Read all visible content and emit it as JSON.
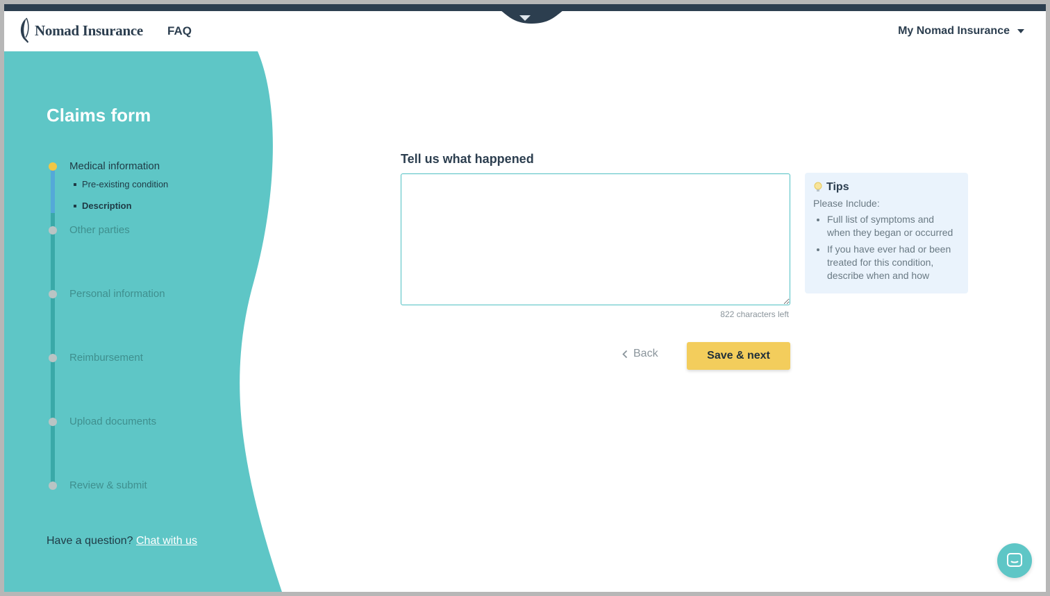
{
  "header": {
    "logo_text": "Nomad Insurance",
    "faq_label": "FAQ",
    "account_label": "My Nomad Insurance"
  },
  "sidebar": {
    "title": "Claims form",
    "steps": [
      {
        "label": "Medical information",
        "state": "active"
      },
      {
        "label": "Other parties",
        "state": "inactive"
      },
      {
        "label": "Personal information",
        "state": "inactive"
      },
      {
        "label": "Reimbursement",
        "state": "inactive"
      },
      {
        "label": "Upload documents",
        "state": "inactive"
      },
      {
        "label": "Review & submit",
        "state": "inactive"
      }
    ],
    "substeps": [
      {
        "label": "Pre-existing condition",
        "current": false
      },
      {
        "label": "Description",
        "current": true
      }
    ],
    "question_text": "Have a question?",
    "chat_link": "Chat with us"
  },
  "form": {
    "field_label": "Tell us what happened",
    "textarea_value": "",
    "counter_text": "822 characters left",
    "back_label": "Back",
    "save_label": "Save & next"
  },
  "tips": {
    "title": "Tips",
    "intro": "Please Include:",
    "items": [
      "Full list of symptoms and when they began or occurred",
      "If you have ever had or been treated for this condition, describe when and how"
    ]
  },
  "colors": {
    "sidebar": "#5ec6c6",
    "navy": "#2c3e4f",
    "accent_yellow": "#f3cd5c",
    "input_border": "#4fc0c3",
    "tips_bg": "#eaf3fc"
  },
  "icons": {
    "logo": "feather-icon",
    "account_caret": "caret-down-icon",
    "collapse": "caret-down-icon",
    "tips": "lightbulb-icon",
    "back": "chevron-left-icon",
    "chat": "chat-bubble-icon"
  }
}
